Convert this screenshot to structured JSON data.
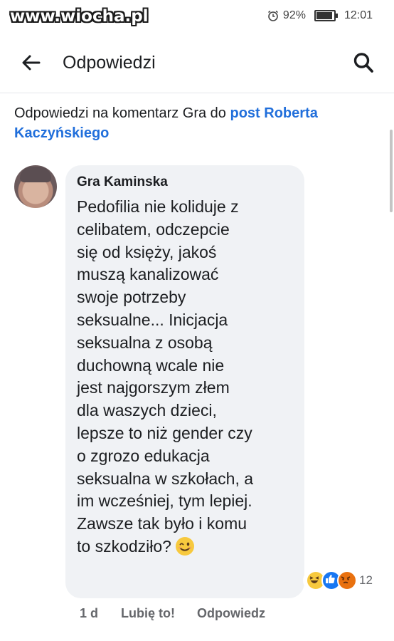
{
  "status_bar": {
    "watermark": "www.wiocha.pl",
    "battery": "92%",
    "battery_level": 0.92,
    "time": "12:01"
  },
  "header": {
    "title": "Odpowiedzi",
    "back_icon": "arrow-left-icon",
    "search_icon": "search-icon"
  },
  "context": {
    "prefix": "Odpowiedzi na komentarz Gra do ",
    "link": "post Roberta Kaczyńskiego"
  },
  "comment": {
    "author": "Gra Kaminska",
    "lines": [
      "Pedofilia nie koliduje z",
      "celibatem, odczepcie",
      "się od księży, jakoś",
      "muszą kanalizować",
      "swoje potrzeby",
      "seksualne...  Inicjacja",
      "seksualna z osobą",
      "duchowną wcale nie",
      "jest najgorszym złem",
      "dla waszych dzieci,",
      "lepsze to niż gender czy",
      "o zgrozo edukacja",
      "seksualna w szkołach, a",
      "im wcześniej, tym lepiej.",
      "Zawsze tak było i komu",
      "to szkodziło?"
    ],
    "emoji": "wink-emoji"
  },
  "reactions": {
    "icons": [
      "haha-icon",
      "like-icon",
      "angry-icon"
    ],
    "count": "12"
  },
  "footer": {
    "time": "1 d",
    "like": "Lubię to!",
    "reply": "Odpowiedz"
  },
  "colors": {
    "link": "#216fdb",
    "bubble": "#f0f2f5",
    "meta": "#65676b"
  }
}
